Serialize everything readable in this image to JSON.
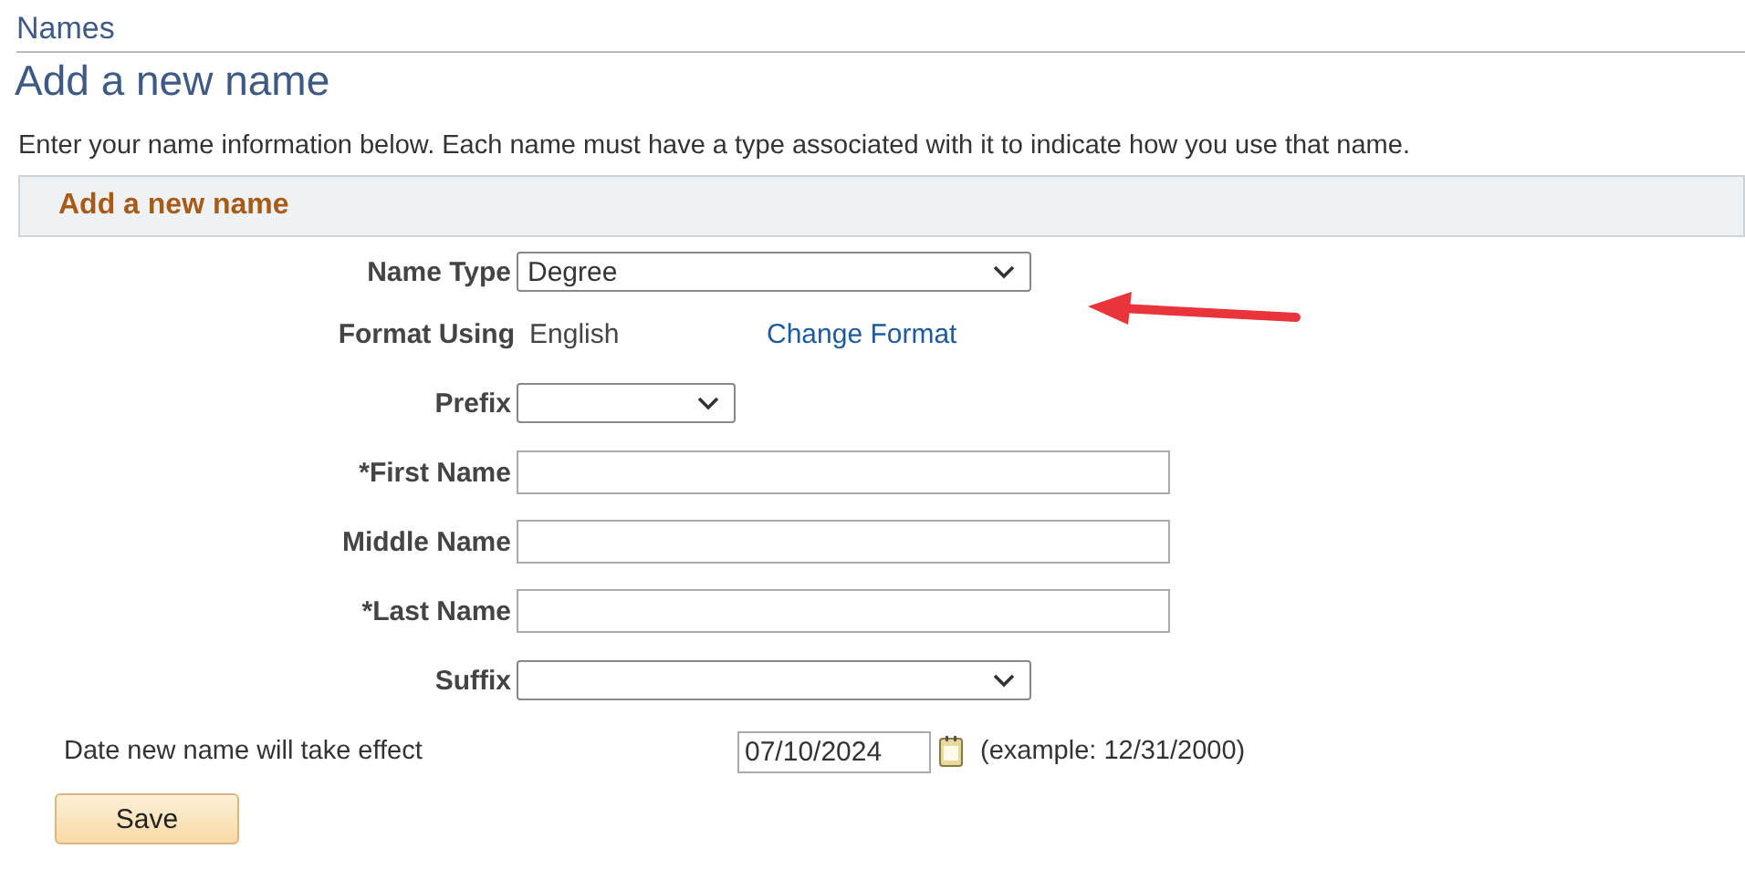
{
  "breadcrumb": "Names",
  "title": "Add a new name",
  "instructions": "Enter your name information below. Each name must have a type associated with it to indicate how you use that name.",
  "section": {
    "title": "Add a new name"
  },
  "fields": [
    {
      "kind": "select",
      "label": "Name Type",
      "value": "Degree"
    },
    {
      "kind": "display",
      "label": "Format Using",
      "value": "English",
      "link": "Change Format"
    },
    {
      "kind": "short_select",
      "label": "Prefix"
    },
    {
      "kind": "text",
      "label": "*First Name"
    },
    {
      "kind": "text",
      "label": "Middle Name"
    },
    {
      "kind": "text",
      "label": "*Last Name"
    },
    {
      "kind": "select",
      "label": "Suffix"
    }
  ],
  "effective_date": {
    "label": "Date new name will take effect",
    "value": "07/10/2024",
    "hint": "(example: 12/31/2000)"
  },
  "save_button": "Save"
}
